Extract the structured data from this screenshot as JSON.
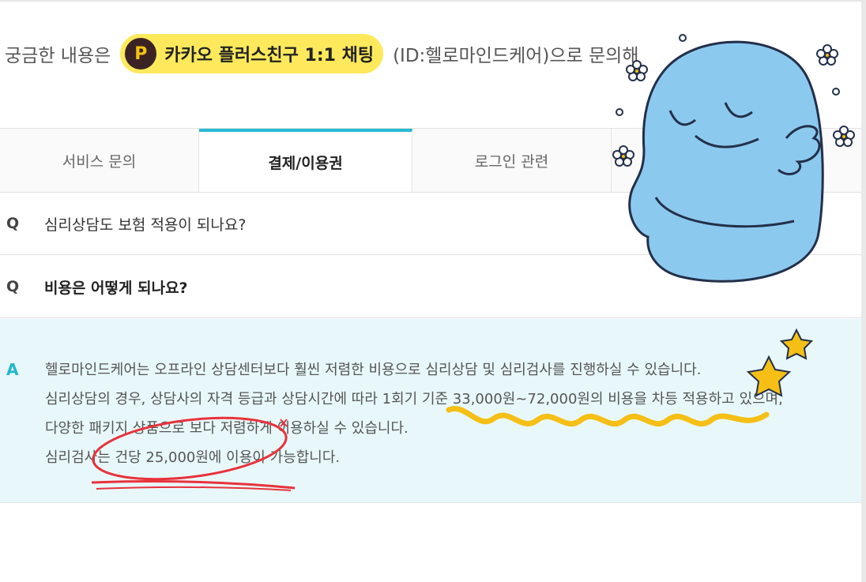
{
  "notice": {
    "prefix": "궁금한 내용은",
    "kakao_label": "카카오 플러스친구 1:1 채팅",
    "kakao_logo": "P",
    "suffix": "(ID:헬로마인드케어)으로 문의해"
  },
  "tabs": [
    {
      "label": "서비스 문의",
      "active": false
    },
    {
      "label": "결제/이용권",
      "active": true
    },
    {
      "label": "로그인 관련",
      "active": false
    }
  ],
  "faq": [
    {
      "marker": "Q",
      "question": "심리상담도 보험 적용이 되나요?"
    },
    {
      "marker": "Q",
      "question": "비용은 어떻게 되나요?"
    }
  ],
  "answer": {
    "marker": "A",
    "lines": [
      "헬로마인드케어는 오프라인 상담센터보다 훨씬 저렴한 비용으로 심리상담 및 심리검사를 진행하실 수 있습니다.",
      "심리상담의 경우, 상담사의 자격 등급과 상담시간에 따라 1회기 기준 33,000원~72,000원의 비용을 차등 적용하고 있으며,",
      "다양한 패키지 상품으로 보다 저렴하게 이용하실 수 있습니다.",
      "심리검사는 건당 25,000원에 이용이 가능합니다."
    ]
  },
  "colors": {
    "accent": "#2ab9d3",
    "kakao_yellow": "#fde95b",
    "answer_bg": "#e8f8fa",
    "sticker_blue": "#8cc9ef",
    "highlight_red": "#e8323c",
    "scribble_yellow": "#f5bf16"
  }
}
